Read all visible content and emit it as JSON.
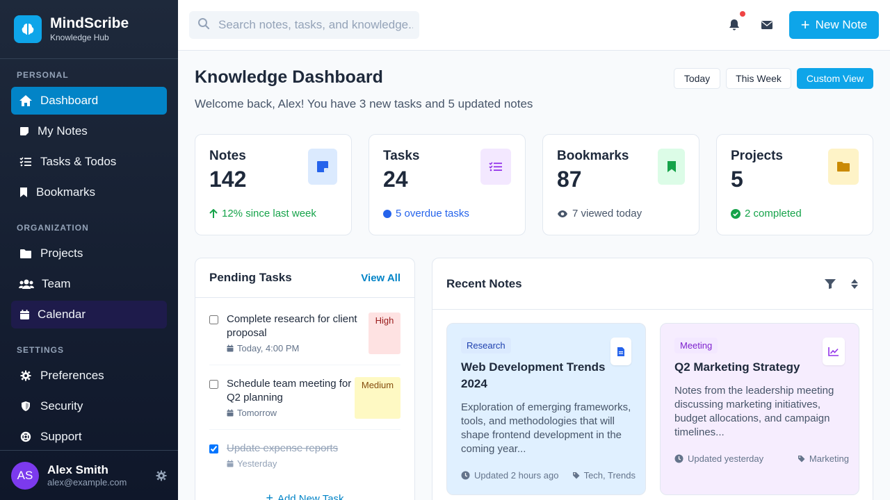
{
  "app": {
    "name": "MindScribe",
    "tagline": "Knowledge Hub",
    "brand_color": "#0ea5e9",
    "logo_icon": "brain-icon"
  },
  "sidebar": {
    "sections": [
      {
        "label": "PERSONAL",
        "items": [
          {
            "label": "Dashboard",
            "icon": "home-icon",
            "active": true
          },
          {
            "label": "My Notes",
            "icon": "note-icon"
          },
          {
            "label": "Tasks & Todos",
            "icon": "list-check-icon"
          },
          {
            "label": "Bookmarks",
            "icon": "bookmark-icon"
          }
        ]
      },
      {
        "label": "ORGANIZATION",
        "items": [
          {
            "label": "Projects",
            "icon": "folder-icon"
          },
          {
            "label": "Team",
            "icon": "users-icon"
          },
          {
            "label": "Calendar",
            "icon": "calendar-icon"
          }
        ]
      },
      {
        "label": "SETTINGS",
        "items": [
          {
            "label": "Preferences",
            "icon": "gear-icon"
          },
          {
            "label": "Security",
            "icon": "shield-icon"
          },
          {
            "label": "Support",
            "icon": "lifebuoy-icon"
          }
        ]
      }
    ]
  },
  "user": {
    "initials": "AS",
    "name": "Alex Smith",
    "email": "alex@example.com"
  },
  "topbar": {
    "search_placeholder": "Search notes, tasks, and knowledge...",
    "new_note_label": "New Note",
    "has_notifications": true
  },
  "dashboard": {
    "title": "Knowledge Dashboard",
    "subtitle": "Welcome back, Alex! You have 3 new tasks and 5 updated notes",
    "views": [
      "Today",
      "This Week",
      "Custom View"
    ],
    "active_view": "Custom View"
  },
  "stats": [
    {
      "label": "Notes",
      "value": "142",
      "foot": "12% since last week",
      "foot_icon": "arrow-up-icon",
      "foot_color": "#16a34a",
      "icon": "note-icon",
      "icon_bg": "#dbeafe",
      "icon_color": "#2563eb"
    },
    {
      "label": "Tasks",
      "value": "24",
      "foot": "5 overdue tasks",
      "foot_icon": "dot-icon",
      "foot_color": "#2563eb",
      "icon": "list-check-icon",
      "icon_bg": "#f3e8ff",
      "icon_color": "#9333ea"
    },
    {
      "label": "Bookmarks",
      "value": "87",
      "foot": "7 viewed today",
      "foot_icon": "eye-icon",
      "foot_color": "#475569",
      "icon": "bookmark-icon",
      "icon_bg": "#dcfce7",
      "icon_color": "#16a34a"
    },
    {
      "label": "Projects",
      "value": "5",
      "foot": "2 completed",
      "foot_icon": "check-circle-icon",
      "foot_color": "#16a34a",
      "icon": "folder-icon",
      "icon_bg": "#fef3c7",
      "icon_color": "#ca8a04"
    }
  ],
  "pending_tasks": {
    "title": "Pending Tasks",
    "view_all": "View All",
    "add_task": "Add New Task",
    "items": [
      {
        "title_line1": "Complete research for client",
        "title_line2": "proposal",
        "due": "Today, 4:00 PM",
        "priority": "High",
        "done": false
      },
      {
        "title_line1": "Schedule team meeting for",
        "title_line2": "Q2 planning",
        "due": "Tomorrow",
        "priority": "Medium",
        "done": false
      },
      {
        "title_line1": "Update expense reports",
        "title_line2": "",
        "due": "Yesterday",
        "priority": "",
        "done": true
      }
    ]
  },
  "recent_notes": {
    "title": "Recent Notes",
    "items": [
      {
        "tag": "Research",
        "title_line1": "Web Development Trends",
        "title_line2": "2024",
        "body": [
          "Exploration of emerging frameworks,",
          "tools, and methodologies that will",
          "shape frontend development in the",
          "coming year..."
        ],
        "updated": "Updated 2 hours ago",
        "labels": "Tech, Trends",
        "icon": "document-icon"
      },
      {
        "tag": "Meeting",
        "title_line1": "Q2 Marketing Strategy",
        "title_line2": "",
        "body": [
          "Notes from the leadership meeting",
          "discussing marketing initiatives,",
          "budget allocations, and campaign",
          "timelines..."
        ],
        "updated": "Updated yesterday",
        "labels": "Marketing",
        "icon": "chart-line-icon"
      }
    ]
  }
}
